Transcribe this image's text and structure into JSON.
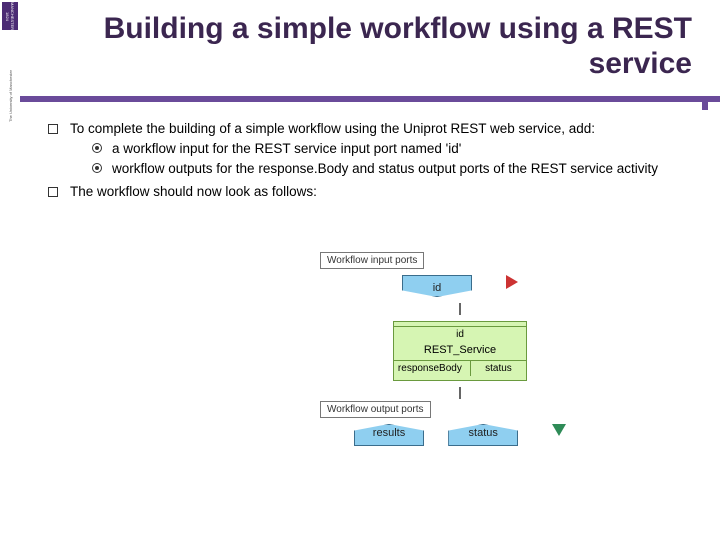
{
  "brand": {
    "name": "MANCHESTER 1824",
    "sub": "The University of Manchester"
  },
  "header": {
    "title": "Building a simple workflow using a REST service"
  },
  "body": {
    "item1": "To complete the building of a simple workflow using the Uniprot REST web service, add:",
    "sub1": "a workflow input for the REST service input port named 'id'",
    "sub2": "workflow outputs for the response.Body and status output ports of the REST service activity",
    "item2": "The workflow should now look as follows:"
  },
  "diagram": {
    "input_section": "Workflow input ports",
    "input_port": "id",
    "svc_in": "id",
    "svc_name": "REST_Service",
    "svc_out1": "responseBody",
    "svc_out2": "status",
    "output_section": "Workflow output ports",
    "out1": "results",
    "out2": "status"
  }
}
